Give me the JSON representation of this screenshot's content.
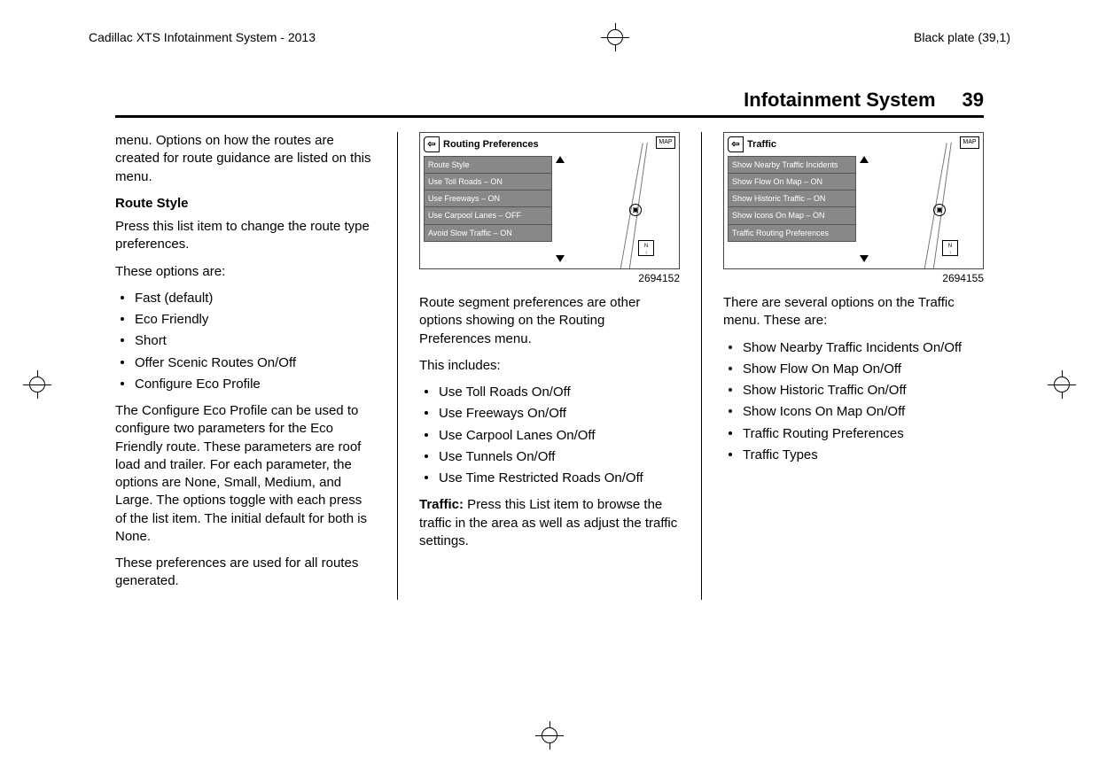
{
  "header": {
    "doc_title": "Cadillac XTS Infotainment System - 2013",
    "plate": "Black plate (39,1)"
  },
  "runhead": {
    "title": "Infotainment System",
    "page": "39"
  },
  "col1": {
    "intro": "menu. Options on how the routes are created for route guidance are listed on this menu.",
    "h1": "Route Style",
    "p1": "Press this list item to change the route type preferences.",
    "p2": "These options are:",
    "list": [
      "Fast (default)",
      "Eco Friendly",
      "Short",
      "Offer Scenic Routes On/Off",
      "Configure Eco Profile"
    ],
    "p3": "The Configure Eco Profile can be used to configure two parameters for the Eco Friendly route. These parameters are roof load and trailer. For each parameter, the options are None, Small, Medium, and Large. The options toggle with each press of the list item. The initial default for both is None.",
    "p4": "These preferences are used for all routes generated."
  },
  "fig1": {
    "title": "Routing Preferences",
    "map": "MAP",
    "rows": [
      "Route Style",
      "Use Toll Roads – ON",
      "Use Freeways – ON",
      "Use Carpool Lanes – OFF",
      "Avoid Slow Traffic – ON"
    ],
    "caption": "2694152"
  },
  "col2": {
    "p1": "Route segment preferences are other options showing on the Routing Preferences menu.",
    "p2": "This includes:",
    "list": [
      "Use Toll Roads On/Off",
      "Use Freeways On/Off",
      "Use Carpool Lanes On/Off",
      "Use Tunnels On/Off",
      "Use Time Restricted Roads On/Off"
    ],
    "p3_label": "Traffic:",
    "p3_body": "  Press this List item to browse the traffic in the area as well as adjust the traffic settings."
  },
  "fig2": {
    "title": "Traffic",
    "map": "MAP",
    "rows": [
      "Show Nearby Traffic Incidents",
      "Show Flow On Map – ON",
      "Show Historic Traffic – ON",
      "Show Icons On Map – ON",
      "Traffic Routing Preferences"
    ],
    "caption": "2694155"
  },
  "col3": {
    "p1": "There are several options on the Traffic menu. These are:",
    "list": [
      "Show Nearby Traffic Incidents On/Off",
      "Show Flow On Map On/Off",
      "Show Historic Traffic On/Off",
      "Show Icons On Map On/Off",
      "Traffic Routing Preferences",
      "Traffic Types"
    ]
  }
}
